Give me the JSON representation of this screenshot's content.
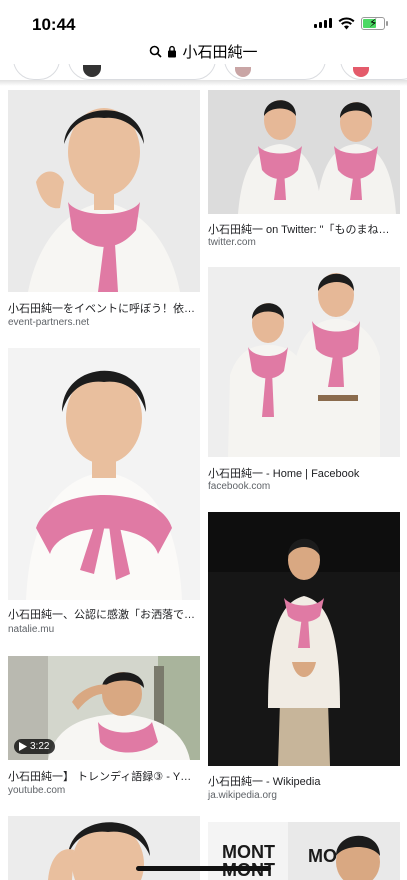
{
  "status": {
    "time": "10:44"
  },
  "url_bar": {
    "query": "小石田純一"
  },
  "results": [
    {
      "caption": "小石田純一をイベントに呼ぼう！依…",
      "source": "event-partners.net"
    },
    {
      "caption": "小石田純一 on Twitter: \"「ものまね…",
      "source": "twitter.com"
    },
    {
      "caption": "小石田純一 - Home | Facebook",
      "source": "facebook.com"
    },
    {
      "caption": "小石田純一、公認に感激「お洒落で…",
      "source": "natalie.mu"
    },
    {
      "caption": "小石田純一】 トレンディ語録③ - Y…",
      "source": "youtube.com",
      "duration": "3:22"
    },
    {
      "caption": "小石田純一 - Wikipedia",
      "source": "ja.wikipedia.org"
    }
  ],
  "colors": {
    "sweater_pink": "#e07aa4",
    "shirt_white": "#f7f6f3",
    "source_gray": "#5f6368"
  }
}
